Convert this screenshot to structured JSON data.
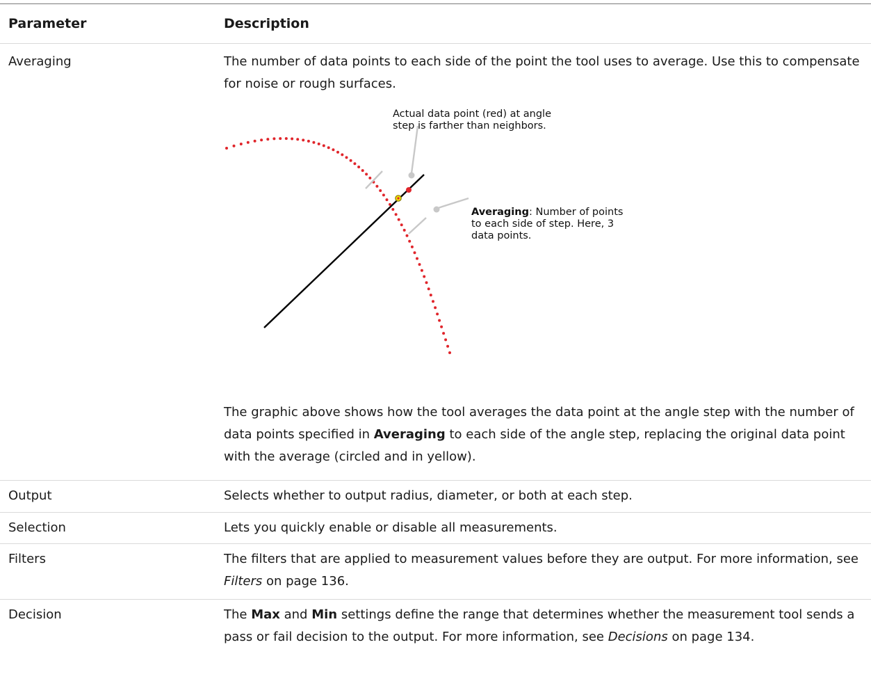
{
  "header": {
    "col1": "Parameter",
    "col2": "Description"
  },
  "rows": {
    "averaging": {
      "name": "Averaging",
      "desc": "The number of data points to each side of the point the tool uses to average. Use this to compensate for noise or rough surfaces.",
      "diagram": {
        "label_top": "Actual data point (red) at angle step is farther than neighbors.",
        "label_right_bold": "Averaging",
        "label_right_rest": ": Number of points to each side of step. Here, 3 data points.",
        "colors": {
          "dots": "#e0252b",
          "line": "#000000",
          "leader": "#c8c8c8",
          "highlight": "#f2e200"
        }
      },
      "after_text": {
        "part1": "The graphic above shows how the tool averages the data point at the angle step with the number of data points specified in ",
        "bold": "Averaging",
        "part2": " to each side of the angle step, replacing the original data point with the average (circled and in yellow)."
      }
    },
    "output": {
      "name": "Output",
      "desc": "Selects whether to output radius, diameter, or both at each step."
    },
    "selection": {
      "name": "Selection",
      "desc": "Lets you quickly enable or disable all measurements."
    },
    "filters": {
      "name": "Filters",
      "desc_part1": "The filters that are applied to measurement values before they are output. For more information, see ",
      "desc_link": "Filters",
      "desc_part2": " on page 136."
    },
    "decision": {
      "name": "Decision",
      "desc_part1": "The ",
      "desc_bold1": "Max",
      "desc_part2": " and ",
      "desc_bold2": "Min",
      "desc_part3": " settings define the range that determines whether the measurement tool sends a pass or fail decision to the output. For more information, see ",
      "desc_link": "Decisions",
      "desc_part4": " on page 134."
    }
  }
}
